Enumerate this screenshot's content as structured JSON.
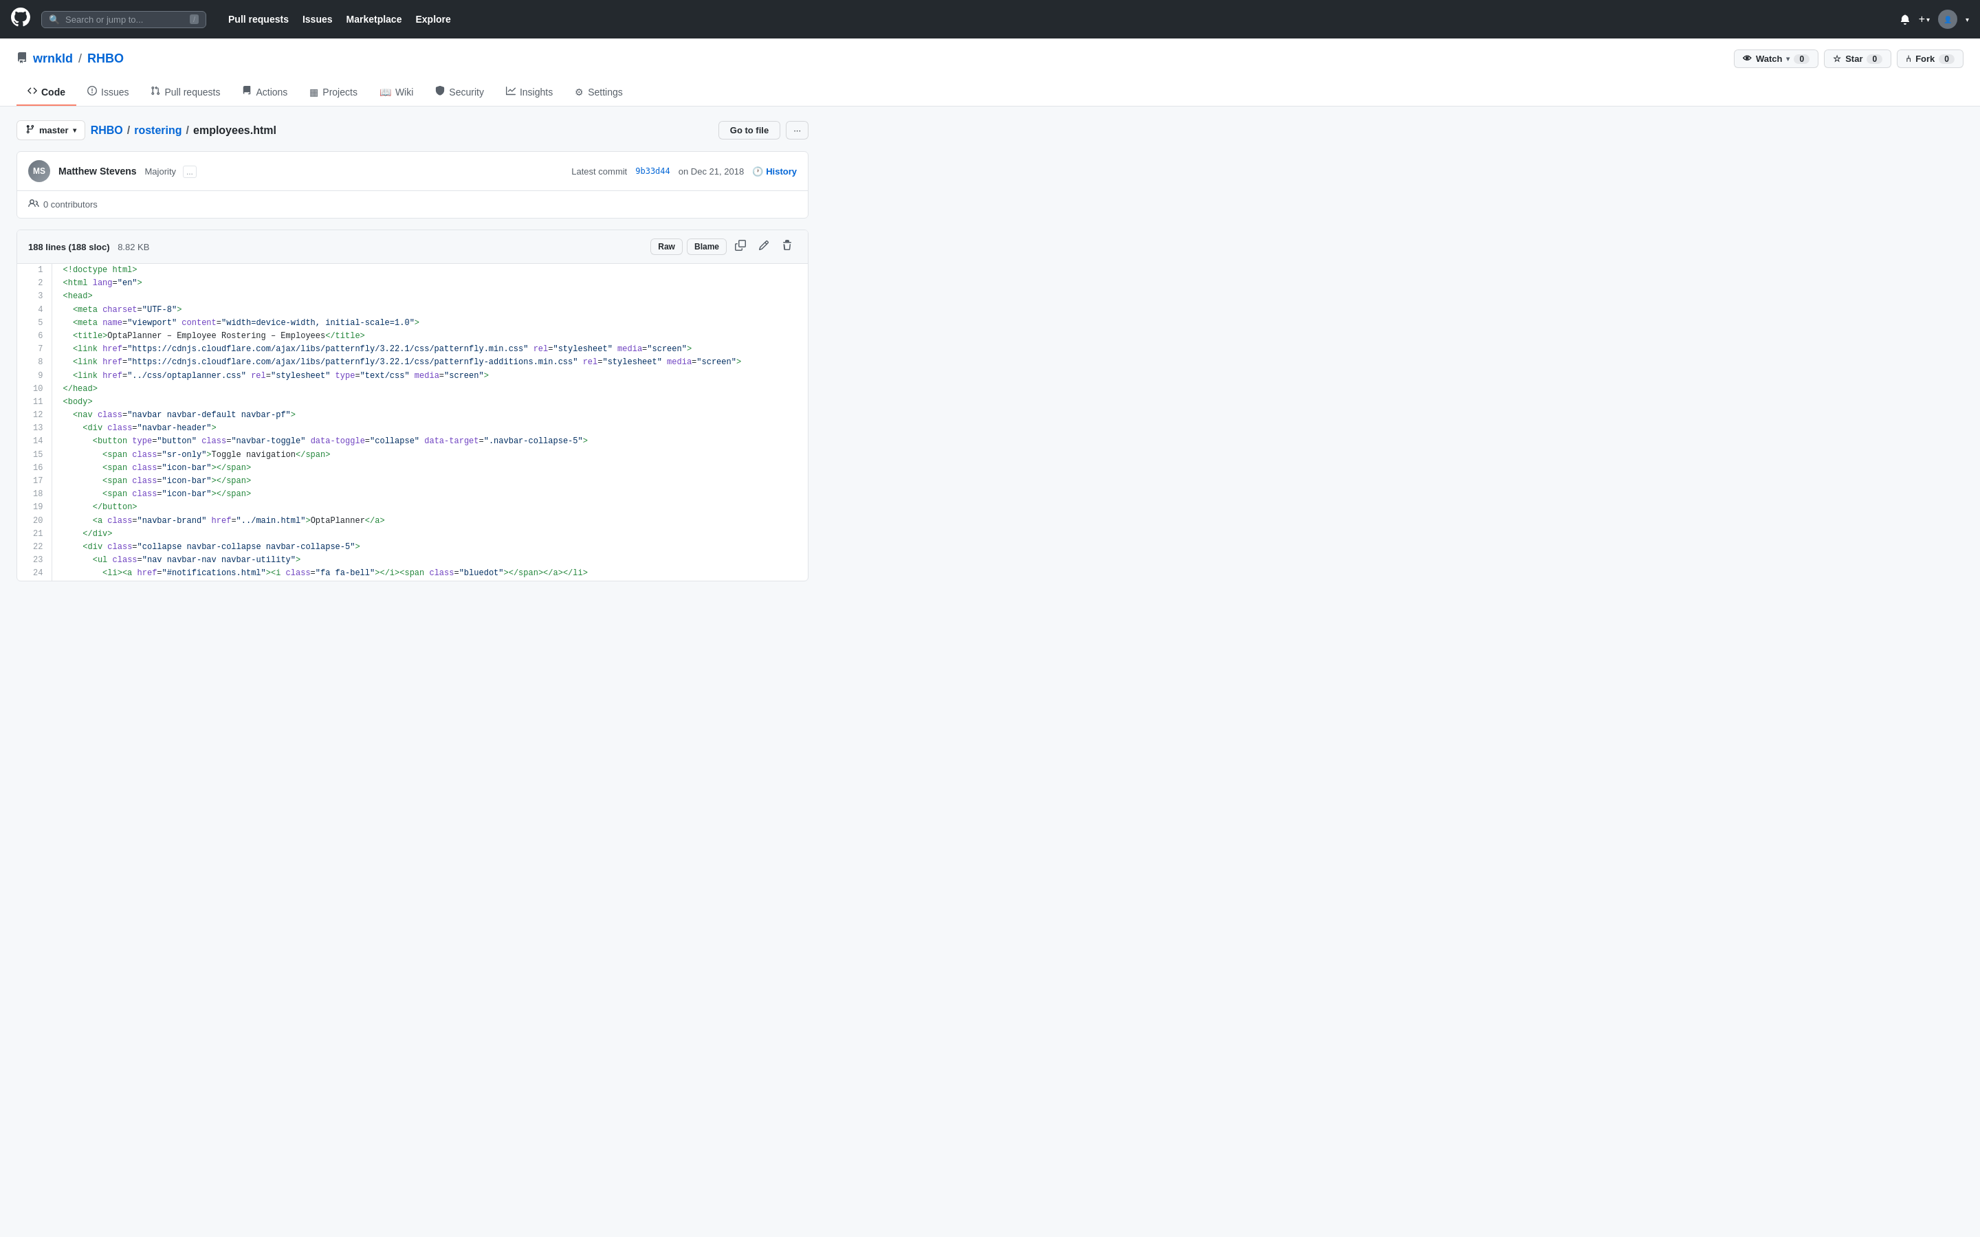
{
  "topnav": {
    "search_placeholder": "Search or jump to...",
    "slash_hint": "/",
    "links": [
      "Pull requests",
      "Issues",
      "Marketplace",
      "Explore"
    ],
    "watch_label": "Watch",
    "watch_count": "0",
    "star_label": "Star",
    "star_count": "0",
    "fork_label": "Fork",
    "fork_count": "0"
  },
  "repo": {
    "owner": "wrnkld",
    "name": "RHBO",
    "tabs": [
      {
        "label": "Code",
        "icon": "◇",
        "active": true
      },
      {
        "label": "Issues",
        "icon": "ℹ"
      },
      {
        "label": "Pull requests",
        "icon": "⇄"
      },
      {
        "label": "Actions",
        "icon": "▶"
      },
      {
        "label": "Projects",
        "icon": "▦"
      },
      {
        "label": "Wiki",
        "icon": "📖"
      },
      {
        "label": "Security",
        "icon": "🛡"
      },
      {
        "label": "Insights",
        "icon": "📈"
      },
      {
        "label": "Settings",
        "icon": "⚙"
      }
    ]
  },
  "breadcrumb": {
    "branch": "master",
    "path_parts": [
      "RHBO",
      "rostering",
      "employees.html"
    ],
    "go_to_file": "Go to file",
    "more": "···"
  },
  "commit": {
    "author_name": "Matthew Stevens",
    "author_initials": "MS",
    "commit_message": "Majority",
    "extra": "...",
    "commit_hash": "9b33d44",
    "commit_date": "on Dec 21, 2018",
    "latest_commit_label": "Latest commit",
    "history_label": "History",
    "contributors_label": "0 contributors"
  },
  "file": {
    "lines_label": "188 lines (188 sloc)",
    "size_label": "8.82 KB",
    "raw_label": "Raw",
    "blame_label": "Blame"
  },
  "code_lines": [
    {
      "num": 1,
      "html": "<span class='hl-tag'>&lt;!doctype html&gt;</span>"
    },
    {
      "num": 2,
      "html": "<span class='hl-tag'>&lt;html</span> <span class='hl-attr'>lang</span>=<span class='hl-str'>\"en\"</span><span class='hl-tag'>&gt;</span>"
    },
    {
      "num": 3,
      "html": "<span class='hl-tag'>&lt;head&gt;</span>"
    },
    {
      "num": 4,
      "html": "  <span class='hl-tag'>&lt;meta</span> <span class='hl-attr'>charset</span>=<span class='hl-str'>\"UTF-8\"</span><span class='hl-tag'>&gt;</span>"
    },
    {
      "num": 5,
      "html": "  <span class='hl-tag'>&lt;meta</span> <span class='hl-attr'>name</span>=<span class='hl-str'>\"viewport\"</span> <span class='hl-attr'>content</span>=<span class='hl-str'>\"width=device-width, initial-scale=1.0\"</span><span class='hl-tag'>&gt;</span>"
    },
    {
      "num": 6,
      "html": "  <span class='hl-tag'>&lt;title&gt;</span><span class='hl-plain'>OptaPlanner – Employee Rostering – Employees</span><span class='hl-tag'>&lt;/title&gt;</span>"
    },
    {
      "num": 7,
      "html": "  <span class='hl-tag'>&lt;link</span> <span class='hl-attr'>href</span>=<span class='hl-str'>\"https://cdnjs.cloudflare.com/ajax/libs/patternfly/3.22.1/css/patternfly.min.css\"</span> <span class='hl-attr'>rel</span>=<span class='hl-str'>\"stylesheet\"</span> <span class='hl-attr'>media</span>=<span class='hl-str'>\"screen\"</span><span class='hl-tag'>&gt;</span>"
    },
    {
      "num": 8,
      "html": "  <span class='hl-tag'>&lt;link</span> <span class='hl-attr'>href</span>=<span class='hl-str'>\"https://cdnjs.cloudflare.com/ajax/libs/patternfly/3.22.1/css/patternfly-additions.min.css\"</span> <span class='hl-attr'>rel</span>=<span class='hl-str'>\"stylesheet\"</span> <span class='hl-attr'>media</span>=<span class='hl-str'>\"screen\"</span><span class='hl-tag'>&gt;</span>"
    },
    {
      "num": 9,
      "html": "  <span class='hl-tag'>&lt;link</span> <span class='hl-attr'>href</span>=<span class='hl-str'>\"../css/optaplanner.css\"</span> <span class='hl-attr'>rel</span>=<span class='hl-str'>\"stylesheet\"</span> <span class='hl-attr'>type</span>=<span class='hl-str'>\"text/css\"</span> <span class='hl-attr'>media</span>=<span class='hl-str'>\"screen\"</span><span class='hl-tag'>&gt;</span>"
    },
    {
      "num": 10,
      "html": "<span class='hl-tag'>&lt;/head&gt;</span>"
    },
    {
      "num": 11,
      "html": "<span class='hl-tag'>&lt;body&gt;</span>"
    },
    {
      "num": 12,
      "html": "  <span class='hl-tag'>&lt;nav</span> <span class='hl-attr'>class</span>=<span class='hl-str'>\"navbar navbar-default navbar-pf\"</span><span class='hl-tag'>&gt;</span>"
    },
    {
      "num": 13,
      "html": "    <span class='hl-tag'>&lt;div</span> <span class='hl-attr'>class</span>=<span class='hl-str'>\"navbar-header\"</span><span class='hl-tag'>&gt;</span>"
    },
    {
      "num": 14,
      "html": "      <span class='hl-tag'>&lt;button</span> <span class='hl-attr'>type</span>=<span class='hl-str'>\"button\"</span> <span class='hl-attr'>class</span>=<span class='hl-str'>\"navbar-toggle\"</span> <span class='hl-attr'>data-toggle</span>=<span class='hl-str'>\"collapse\"</span> <span class='hl-attr'>data-target</span>=<span class='hl-str'>\".navbar-collapse-5\"</span><span class='hl-tag'>&gt;</span>"
    },
    {
      "num": 15,
      "html": "        <span class='hl-tag'>&lt;span</span> <span class='hl-attr'>class</span>=<span class='hl-str'>\"sr-only\"</span><span class='hl-tag'>&gt;</span><span class='hl-plain'>Toggle navigation</span><span class='hl-tag'>&lt;/span&gt;</span>"
    },
    {
      "num": 16,
      "html": "        <span class='hl-tag'>&lt;span</span> <span class='hl-attr'>class</span>=<span class='hl-str'>\"icon-bar\"</span><span class='hl-tag'>&gt;&lt;/span&gt;</span>"
    },
    {
      "num": 17,
      "html": "        <span class='hl-tag'>&lt;span</span> <span class='hl-attr'>class</span>=<span class='hl-str'>\"icon-bar\"</span><span class='hl-tag'>&gt;&lt;/span&gt;</span>"
    },
    {
      "num": 18,
      "html": "        <span class='hl-tag'>&lt;span</span> <span class='hl-attr'>class</span>=<span class='hl-str'>\"icon-bar\"</span><span class='hl-tag'>&gt;&lt;/span&gt;</span>"
    },
    {
      "num": 19,
      "html": "      <span class='hl-tag'>&lt;/button&gt;</span>"
    },
    {
      "num": 20,
      "html": "      <span class='hl-tag'>&lt;a</span> <span class='hl-attr'>class</span>=<span class='hl-str'>\"navbar-brand\"</span> <span class='hl-attr'>href</span>=<span class='hl-str'>\"../main.html\"</span><span class='hl-tag'>&gt;</span><span class='hl-plain'>OptaPlanner</span><span class='hl-tag'>&lt;/a&gt;</span>"
    },
    {
      "num": 21,
      "html": "    <span class='hl-tag'>&lt;/div&gt;</span>"
    },
    {
      "num": 22,
      "html": "    <span class='hl-tag'>&lt;div</span> <span class='hl-attr'>class</span>=<span class='hl-str'>\"collapse navbar-collapse navbar-collapse-5\"</span><span class='hl-tag'>&gt;</span>"
    },
    {
      "num": 23,
      "html": "      <span class='hl-tag'>&lt;ul</span> <span class='hl-attr'>class</span>=<span class='hl-str'>\"nav navbar-nav navbar-utility\"</span><span class='hl-tag'>&gt;</span>"
    },
    {
      "num": 24,
      "html": "        <span class='hl-tag'>&lt;li&gt;&lt;a</span> <span class='hl-attr'>href</span>=<span class='hl-str'>\"#notifications.html\"</span><span class='hl-tag'>&gt;&lt;i</span> <span class='hl-attr'>class</span>=<span class='hl-str'>\"fa fa-bell\"</span><span class='hl-tag'>&gt;&lt;/i&gt;&lt;span</span> <span class='hl-attr'>class</span>=<span class='hl-str'>\"bluedot\"</span><span class='hl-tag'>&gt;&lt;/span&gt;&lt;/a&gt;&lt;/li&gt;</span>"
    }
  ]
}
